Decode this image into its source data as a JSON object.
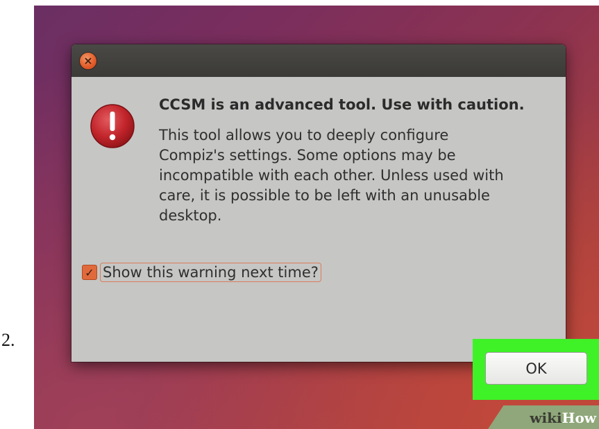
{
  "step_number": "2.",
  "dialog": {
    "close_icon": "close-icon",
    "warning_icon": "exclamation-icon",
    "headline": "CCSM is an advanced tool. Use with caution.",
    "body_lines": [
      "This tool allows you to deeply configure",
      "Compiz's settings. Some options may be",
      "incompatible with each other. Unless used with",
      "care, it is possible to be left with an unusable",
      "desktop."
    ],
    "checkbox": {
      "label": "Show this warning next time?",
      "checked": true
    },
    "ok_label": "OK"
  },
  "watermark": {
    "part1": "wiki",
    "part2": "How"
  },
  "colors": {
    "highlight": "#3ef227",
    "accent": "#e06a3c",
    "warning_red": "#c0242a"
  }
}
